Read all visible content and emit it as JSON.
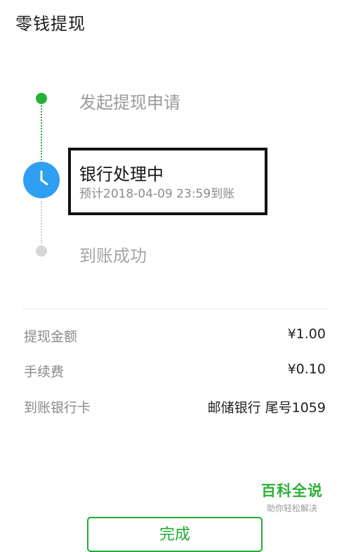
{
  "header": {
    "title": "零钱提现"
  },
  "timeline": {
    "steps": [
      {
        "label": "发起提现申请",
        "status": "done"
      },
      {
        "label": "银行处理中",
        "sub": "预计2018-04-09 23:59到账",
        "status": "current"
      },
      {
        "label": "到账成功",
        "status": "pending"
      }
    ]
  },
  "details": [
    {
      "label": "提现金额",
      "value": "¥1.00"
    },
    {
      "label": "手续费",
      "value": "¥0.10"
    },
    {
      "label": "到账银行卡",
      "value": "邮储银行 尾号1059"
    }
  ],
  "footer": {
    "done_label": "完成"
  },
  "watermark": {
    "main": "百科全说",
    "sub": "助你轻松解决"
  },
  "colors": {
    "accent": "#22b23a",
    "clock": "#2f9ff1",
    "pending": "#d7d7d7"
  },
  "icons": {
    "current_step": "clock-icon"
  }
}
